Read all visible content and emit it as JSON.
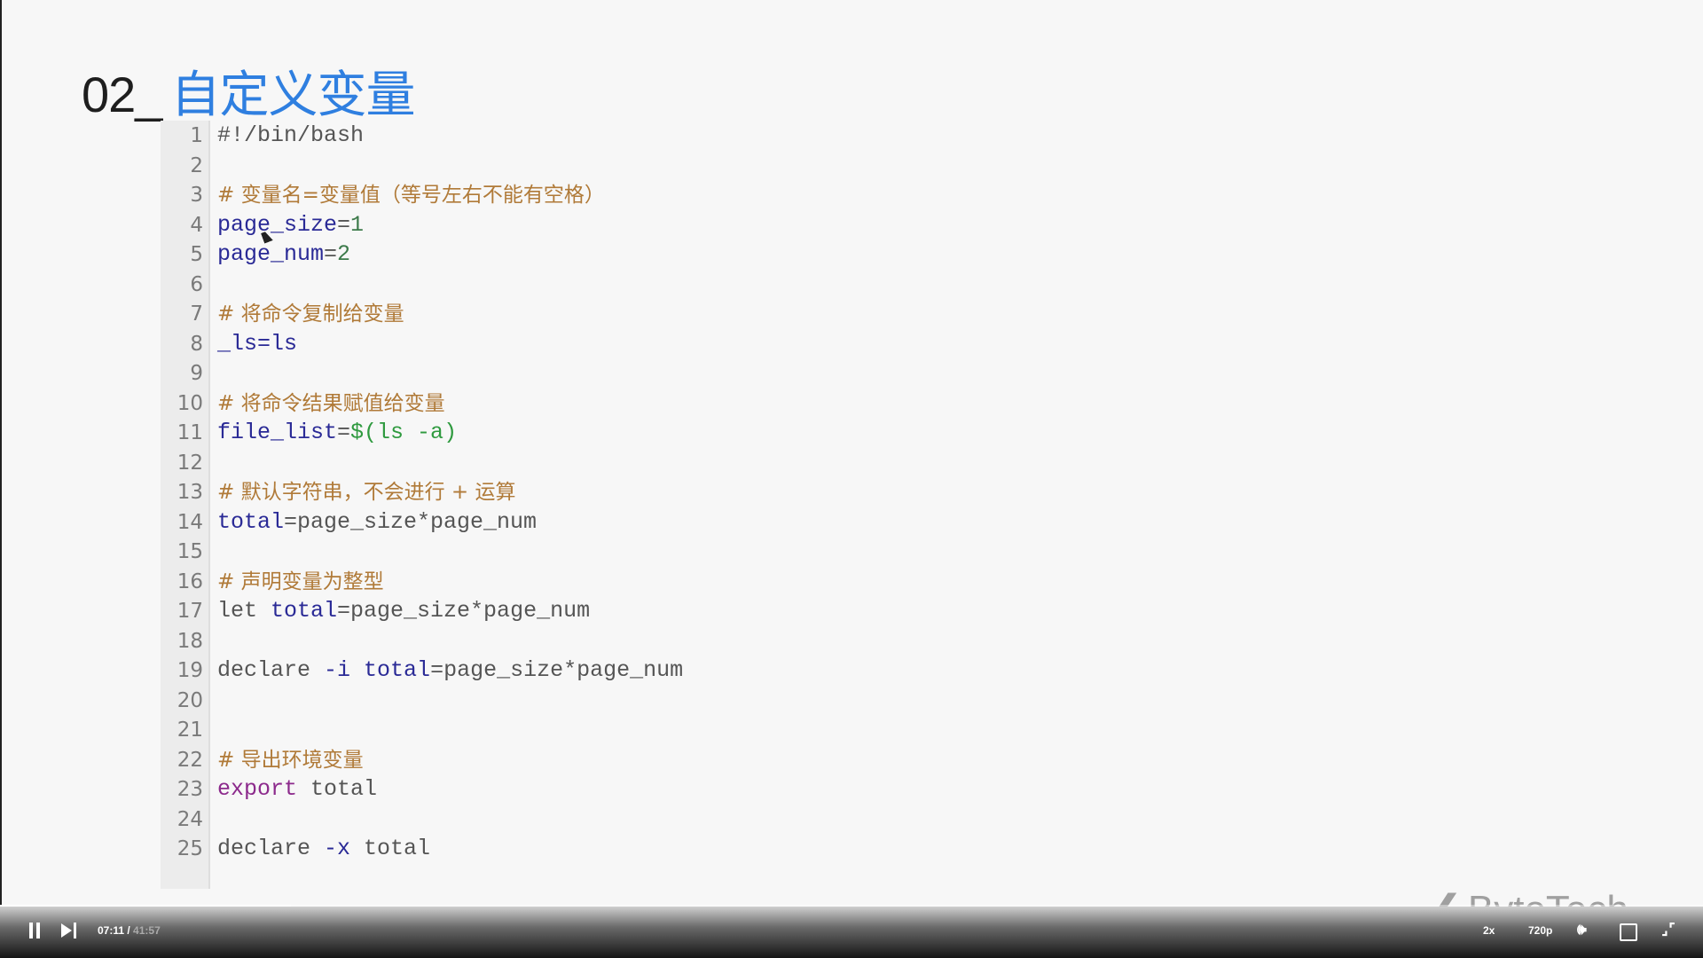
{
  "slide": {
    "title_num": "02_",
    "title_text": "自定义变量",
    "code_lines": [
      {
        "n": "1",
        "tokens": [
          [
            "#!/bin/bash",
            "plain"
          ]
        ]
      },
      {
        "n": "2",
        "tokens": []
      },
      {
        "n": "3",
        "tokens": [
          [
            "# 变量名=变量值（等号左右不能有空格）",
            "comment"
          ]
        ]
      },
      {
        "n": "4",
        "tokens": [
          [
            "page_size",
            "var"
          ],
          [
            "=",
            "plain"
          ],
          [
            "1",
            "num"
          ]
        ]
      },
      {
        "n": "5",
        "tokens": [
          [
            "page_num",
            "var"
          ],
          [
            "=",
            "plain"
          ],
          [
            "2",
            "num"
          ]
        ]
      },
      {
        "n": "6",
        "tokens": []
      },
      {
        "n": "7",
        "tokens": [
          [
            "# 将命令复制给变量",
            "comment"
          ]
        ]
      },
      {
        "n": "8",
        "tokens": [
          [
            "_ls=ls",
            "var"
          ]
        ]
      },
      {
        "n": "9",
        "tokens": []
      },
      {
        "n": "10",
        "tokens": [
          [
            "# 将命令结果赋值给变量",
            "comment"
          ]
        ]
      },
      {
        "n": "11",
        "tokens": [
          [
            "file_list",
            "var"
          ],
          [
            "=",
            "plain"
          ],
          [
            "$(ls -a)",
            "green"
          ]
        ]
      },
      {
        "n": "12",
        "tokens": []
      },
      {
        "n": "13",
        "tokens": [
          [
            "# 默认字符串，不会进行 + 运算",
            "comment"
          ]
        ]
      },
      {
        "n": "14",
        "tokens": [
          [
            "total",
            "var"
          ],
          [
            "=page_size*page_num",
            "plain"
          ]
        ]
      },
      {
        "n": "15",
        "tokens": []
      },
      {
        "n": "16",
        "tokens": [
          [
            "# 声明变量为整型",
            "comment"
          ]
        ]
      },
      {
        "n": "17",
        "tokens": [
          [
            "let ",
            "plain"
          ],
          [
            "total",
            "var"
          ],
          [
            "=page_size*page_num",
            "plain"
          ]
        ]
      },
      {
        "n": "18",
        "tokens": []
      },
      {
        "n": "19",
        "tokens": [
          [
            "declare ",
            "plain"
          ],
          [
            "-i ",
            "flag"
          ],
          [
            "total",
            "var"
          ],
          [
            "=page_size*page_num",
            "plain"
          ]
        ]
      },
      {
        "n": "20",
        "tokens": []
      },
      {
        "n": "21",
        "tokens": []
      },
      {
        "n": "22",
        "tokens": [
          [
            "# 导出环境变量",
            "comment"
          ]
        ]
      },
      {
        "n": "23",
        "tokens": [
          [
            "export",
            "kw"
          ],
          [
            " total",
            "plain"
          ]
        ]
      },
      {
        "n": "24",
        "tokens": []
      },
      {
        "n": "25",
        "tokens": [
          [
            "declare ",
            "plain"
          ],
          [
            "-x",
            "flag"
          ],
          [
            " total",
            "plain"
          ]
        ]
      }
    ]
  },
  "watermark_logo": "ByteTech",
  "player": {
    "current_time": "07:11",
    "separator": " / ",
    "duration": "41:57",
    "progress_percent": 17.1,
    "speed": "2x",
    "quality": "720p",
    "icons": [
      "pause-icon",
      "next-icon",
      "volume-icon",
      "fullscreen-icon",
      "exit-fullscreen-icon"
    ]
  }
}
